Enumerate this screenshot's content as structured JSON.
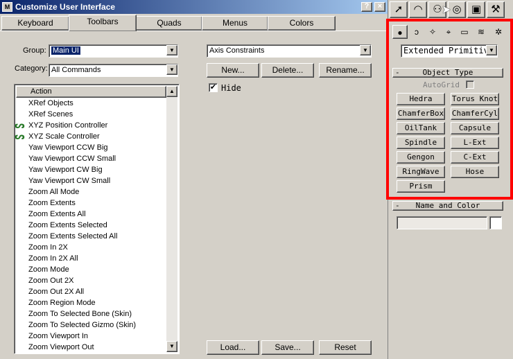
{
  "window": {
    "title": "Customize User Interface",
    "help_label": "?",
    "close_label": "×"
  },
  "tabs": [
    {
      "label": "Keyboard",
      "active": false
    },
    {
      "label": "Toolbars",
      "active": true
    },
    {
      "label": "Quads",
      "active": false
    },
    {
      "label": "Menus",
      "active": false
    },
    {
      "label": "Colors",
      "active": false
    }
  ],
  "form": {
    "group_label": "Group:",
    "group_value": "Main UI",
    "category_label": "Category:",
    "category_value": "All Commands",
    "toolbar_value": "Axis Constraints",
    "new_label": "New...",
    "delete_label": "Delete...",
    "rename_label": "Rename...",
    "hide_label": "Hide",
    "hide_checked": true,
    "load_label": "Load...",
    "save_label": "Save...",
    "reset_label": "Reset"
  },
  "action_list": {
    "header": "Action",
    "items": [
      {
        "label": "XRef Objects",
        "icon": ""
      },
      {
        "label": "XRef Scenes",
        "icon": ""
      },
      {
        "label": "XYZ Position Controller",
        "icon": "controller-icon"
      },
      {
        "label": "XYZ Scale Controller",
        "icon": "controller-icon"
      },
      {
        "label": "Yaw Viewport CCW Big",
        "icon": ""
      },
      {
        "label": "Yaw Viewport CCW Small",
        "icon": ""
      },
      {
        "label": "Yaw Viewport CW Big",
        "icon": ""
      },
      {
        "label": "Yaw Viewport CW Small",
        "icon": ""
      },
      {
        "label": "Zoom All Mode",
        "icon": ""
      },
      {
        "label": "Zoom Extents",
        "icon": ""
      },
      {
        "label": "Zoom Extents All",
        "icon": ""
      },
      {
        "label": "Zoom Extents Selected",
        "icon": ""
      },
      {
        "label": "Zoom Extents Selected All",
        "icon": ""
      },
      {
        "label": "Zoom In 2X",
        "icon": ""
      },
      {
        "label": "Zoom In 2X All",
        "icon": ""
      },
      {
        "label": "Zoom Mode",
        "icon": ""
      },
      {
        "label": "Zoom Out 2X",
        "icon": ""
      },
      {
        "label": "Zoom Out 2X All",
        "icon": ""
      },
      {
        "label": "Zoom Region Mode",
        "icon": ""
      },
      {
        "label": "Zoom To Selected Bone (Skin)",
        "icon": ""
      },
      {
        "label": "Zoom To Selected Gizmo (Skin)",
        "icon": ""
      },
      {
        "label": "Zoom Viewport In",
        "icon": ""
      },
      {
        "label": "Zoom Viewport Out",
        "icon": ""
      }
    ]
  },
  "command_panel": {
    "top_icons": [
      "create-arrow-icon",
      "curve-icon",
      "hierarchy-icon",
      "motion-icon",
      "display-icon",
      "utilities-hammer-icon"
    ],
    "sub_icons": [
      "geometry-sphere-icon",
      "shapes-icon",
      "lights-icon",
      "cameras-icon",
      "helpers-icon",
      "spacewarps-icon",
      "systems-icon"
    ],
    "dropdown_value": "Extended Primitiv",
    "object_type": {
      "title": "Object Type",
      "minus": "-",
      "autogrid_label": "AutoGrid",
      "buttons": [
        "Hedra",
        "Torus Knot",
        "ChamferBox",
        "ChamferCyl",
        "OilTank",
        "Capsule",
        "Spindle",
        "L-Ext",
        "Gengon",
        "C-Ext",
        "RingWave",
        "Hose",
        "Prism"
      ]
    },
    "name_color": {
      "title": "Name and Color",
      "minus": "-",
      "name_value": "",
      "swatch_color": "#ffffff"
    },
    "highlight_color": "#ff0000"
  }
}
